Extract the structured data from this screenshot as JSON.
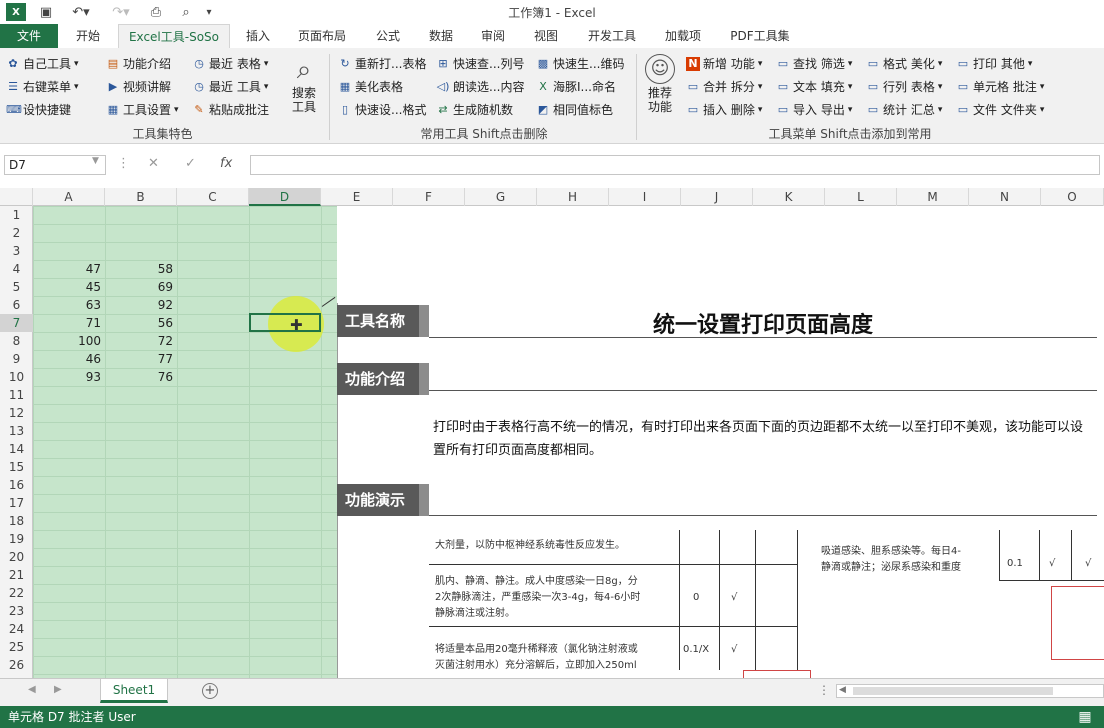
{
  "window": {
    "title": "工作簿1 - Excel"
  },
  "tabs": [
    "文件",
    "开始",
    "Excel工具-SoSo",
    "插入",
    "页面布局",
    "公式",
    "数据",
    "审阅",
    "视图",
    "开发工具",
    "加载项",
    "PDF工具集"
  ],
  "ribbon": {
    "g1": {
      "items": [
        "自己工具",
        "右键菜单",
        "设快捷键",
        "功能介绍",
        "视频讲解",
        "工具设置",
        "最近 表格",
        "最近 工具",
        "粘贴成批注"
      ],
      "big": "搜索\n工具",
      "label": "工具集特色"
    },
    "g2": {
      "items": [
        "重新打...表格",
        "美化表格",
        "快速设...格式",
        "快速查...列号",
        "朗读选...内容",
        "生成随机数",
        "快速生...维码",
        "海豚I...命名",
        "相同值标色"
      ],
      "label": "常用工具 Shift点击删除"
    },
    "g3": {
      "big": "推荐\n功能",
      "items": [
        "新增 功能",
        "合并 拆分",
        "插入 删除",
        "查找 筛选",
        "文本 填充",
        "导入 导出",
        "格式 美化",
        "行列 表格",
        "统计 汇总",
        "打印 其他",
        "单元格 批注",
        "文件 文件夹"
      ],
      "label": "工具菜单 Shift点击添加到常用"
    }
  },
  "formula_bar": {
    "name_box": "D7",
    "cancel": "✕",
    "enter": "✓",
    "fx": "fx",
    "value": ""
  },
  "columns": [
    "A",
    "B",
    "C",
    "D",
    "E",
    "F",
    "G",
    "H",
    "I",
    "J",
    "K",
    "L",
    "M",
    "N",
    "O"
  ],
  "rows": [
    "1",
    "2",
    "3",
    "4",
    "5",
    "6",
    "7",
    "8",
    "9",
    "10",
    "11",
    "12",
    "13",
    "14",
    "15",
    "16",
    "17",
    "18",
    "19",
    "20",
    "21",
    "22",
    "23",
    "24",
    "25",
    "26"
  ],
  "cells": [
    [
      "47",
      "58"
    ],
    [
      "45",
      "69"
    ],
    [
      "63",
      "92"
    ],
    [
      "71",
      "56"
    ],
    [
      "100",
      "72"
    ],
    [
      "46",
      "77"
    ],
    [
      "93",
      "76"
    ]
  ],
  "panel": {
    "name_label": "工具名称",
    "name_value": "统一设置打印页面高度",
    "intro_label": "功能介绍",
    "intro_text": "打印时由于表格行高不统一的情况，有时打印出来各页面下面的页边距都不太统一以至打印不美观，该功能可以设置所有打印页面高度都相同。",
    "demo_label": "功能演示",
    "demo_texts": [
      "大剂量，以防中枢神经系统毒性反应发生。",
      "肌内、静滴、静注。成人中度感染一日8g，分",
      "2次静脉滴注，严重感染一次3-4g，每4-6小时",
      "静脉滴注或注射。",
      "将适量本品用20毫升稀释液（氯化钠注射液或",
      "灭菌注射用水）充分溶解后，立即加入250ml",
      "0",
      "√",
      "0.1/X",
      "√",
      "吸道感染、胆系感染等。每日4-",
      "静滴或静注；泌尿系感染和重度",
      "0.1",
      "√",
      "√"
    ]
  },
  "sheets": [
    "Sheet1"
  ],
  "status": "单元格 D7 批注者 User"
}
